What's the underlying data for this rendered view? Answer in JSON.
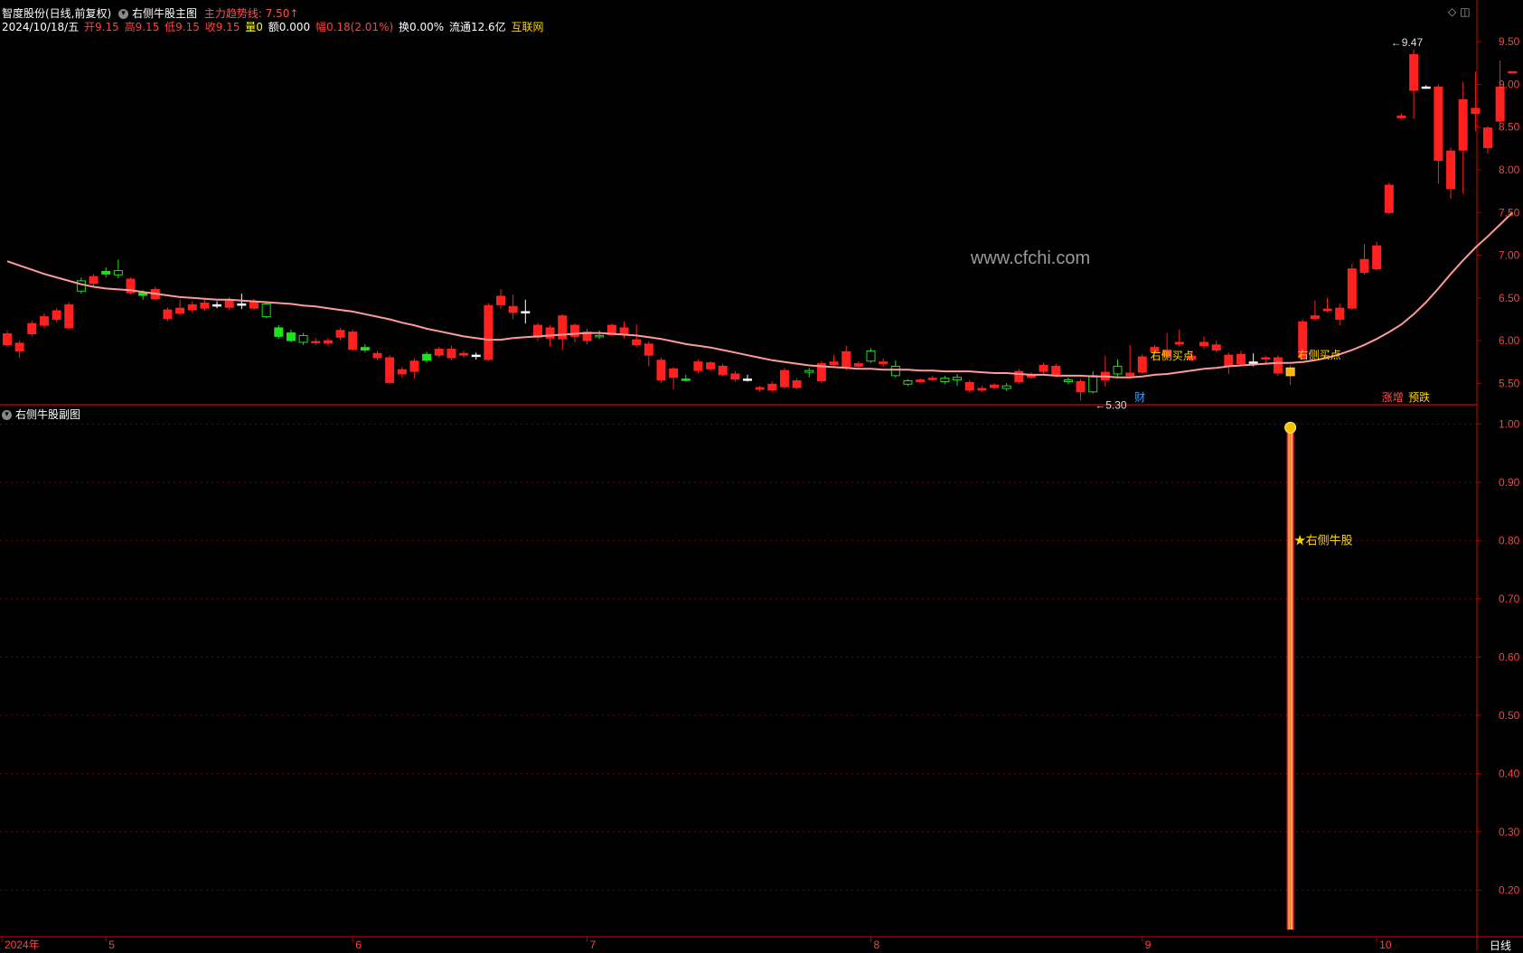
{
  "header": {
    "stock": "智度股份(日线,前复权)",
    "main_indicator": "右侧牛股主图",
    "trend_label": "主力趋势线: 7.50↑",
    "date": "2024/10/18/五",
    "open": "开9.15",
    "high": "高9.15",
    "low": "低9.15",
    "close": "收9.15",
    "volume": "量0",
    "amount": "额0.000",
    "change": "幅0.18(2.01%)",
    "turnover": "换0.00%",
    "float_cap": "流通12.6亿",
    "concept": "互联网"
  },
  "sub_header": {
    "title": "右侧牛股副图"
  },
  "watermark": "www.cfchi.com",
  "period_label": "日线",
  "colors": {
    "up": "#ff2020",
    "down": "#20e020",
    "flat": "#ffffff",
    "ma": "#ff9a9a",
    "axis": "#b00000",
    "grid": "#7a0000",
    "label_yellow": "#ffd700"
  },
  "chart_data": [
    {
      "type": "candlestick",
      "title": "右侧牛股主图",
      "ylim": [
        5.25,
        9.65
      ],
      "yticks": [
        "9.50",
        "9.00",
        "8.50",
        "8.00",
        "7.50",
        "7.00",
        "6.50",
        "6.00",
        "5.50"
      ],
      "xticks": [
        {
          "label": "2024年",
          "index": 0
        },
        {
          "label": "5",
          "index": 8
        },
        {
          "label": "6",
          "index": 28
        },
        {
          "label": "7",
          "index": 47
        },
        {
          "label": "8",
          "index": 70
        },
        {
          "label": "9",
          "index": 92
        },
        {
          "label": "10",
          "index": 111
        }
      ],
      "candles": [
        [
          5.95,
          6.08,
          6.12,
          5.92
        ],
        [
          5.88,
          5.97,
          6.0,
          5.8
        ],
        [
          6.08,
          6.2,
          6.23,
          6.05
        ],
        [
          6.18,
          6.28,
          6.32,
          6.15
        ],
        [
          6.25,
          6.35,
          6.38,
          6.22
        ],
        [
          6.15,
          6.42,
          6.45,
          6.13
        ],
        [
          6.7,
          6.58,
          6.74,
          6.55
        ],
        [
          6.67,
          6.75,
          6.78,
          6.62
        ],
        [
          6.81,
          6.78,
          6.86,
          6.74
        ],
        [
          6.82,
          6.77,
          6.95,
          6.73
        ],
        [
          6.56,
          6.72,
          6.74,
          6.54
        ],
        [
          6.56,
          6.53,
          6.59,
          6.48
        ],
        [
          6.49,
          6.6,
          6.63,
          6.47
        ],
        [
          6.26,
          6.36,
          6.39,
          6.23
        ],
        [
          6.32,
          6.38,
          6.48,
          6.3
        ],
        [
          6.36,
          6.42,
          6.46,
          6.33
        ],
        [
          6.38,
          6.44,
          6.48,
          6.35
        ],
        [
          6.42,
          6.42,
          6.46,
          6.38
        ],
        [
          6.39,
          6.47,
          6.51,
          6.36
        ],
        [
          6.43,
          6.43,
          6.55,
          6.37
        ],
        [
          6.38,
          6.45,
          6.49,
          6.36
        ],
        [
          6.43,
          6.28,
          6.46,
          6.26
        ],
        [
          6.15,
          6.05,
          6.18,
          6.02
        ],
        [
          6.09,
          6.0,
          6.13,
          5.98
        ],
        [
          6.06,
          5.98,
          6.09,
          5.95
        ],
        [
          5.99,
          5.99,
          6.03,
          5.95
        ],
        [
          5.97,
          6.0,
          6.03,
          5.94
        ],
        [
          6.04,
          6.12,
          6.15,
          6.01
        ],
        [
          5.9,
          6.1,
          6.13,
          5.88
        ],
        [
          5.92,
          5.89,
          5.96,
          5.86
        ],
        [
          5.8,
          5.85,
          5.88,
          5.77
        ],
        [
          5.51,
          5.8,
          5.83,
          5.49
        ],
        [
          5.61,
          5.66,
          5.69,
          5.57
        ],
        [
          5.64,
          5.76,
          5.79,
          5.56
        ],
        [
          5.84,
          5.77,
          5.87,
          5.74
        ],
        [
          5.83,
          5.9,
          5.93,
          5.8
        ],
        [
          5.8,
          5.9,
          5.94,
          5.77
        ],
        [
          5.83,
          5.85,
          5.88,
          5.8
        ],
        [
          5.83,
          5.83,
          5.86,
          5.78
        ],
        [
          5.78,
          6.41,
          6.44,
          5.76
        ],
        [
          6.42,
          6.52,
          6.6,
          6.37
        ],
        [
          6.33,
          6.4,
          6.54,
          6.25
        ],
        [
          6.34,
          6.34,
          6.48,
          6.2
        ],
        [
          6.04,
          6.18,
          6.21,
          6.0
        ],
        [
          6.03,
          6.15,
          6.18,
          5.93
        ],
        [
          6.02,
          6.29,
          6.31,
          5.89
        ],
        [
          6.05,
          6.18,
          6.2,
          5.98
        ],
        [
          6.0,
          6.1,
          6.14,
          5.96
        ],
        [
          6.06,
          6.05,
          6.12,
          6.02
        ],
        [
          6.07,
          6.18,
          6.2,
          6.05
        ],
        [
          6.07,
          6.15,
          6.22,
          6.03
        ],
        [
          5.95,
          6.01,
          6.19,
          5.92
        ],
        [
          5.83,
          5.96,
          5.99,
          5.7
        ],
        [
          5.54,
          5.77,
          5.8,
          5.5
        ],
        [
          5.57,
          5.67,
          5.69,
          5.43
        ],
        [
          5.55,
          5.54,
          5.6,
          5.52
        ],
        [
          5.65,
          5.75,
          5.78,
          5.62
        ],
        [
          5.67,
          5.74,
          5.76,
          5.64
        ],
        [
          5.6,
          5.7,
          5.73,
          5.58
        ],
        [
          5.55,
          5.61,
          5.64,
          5.52
        ],
        [
          5.55,
          5.55,
          5.6,
          5.52
        ],
        [
          5.43,
          5.45,
          5.47,
          5.4
        ],
        [
          5.42,
          5.49,
          5.52,
          5.4
        ],
        [
          5.46,
          5.65,
          5.68,
          5.44
        ],
        [
          5.45,
          5.53,
          5.56,
          5.43
        ],
        [
          5.65,
          5.63,
          5.68,
          5.57
        ],
        [
          5.53,
          5.73,
          5.76,
          5.5
        ],
        [
          5.72,
          5.75,
          5.83,
          5.7
        ],
        [
          5.68,
          5.87,
          5.94,
          5.65
        ],
        [
          5.7,
          5.73,
          5.76,
          5.68
        ],
        [
          5.88,
          5.76,
          5.91,
          5.74
        ],
        [
          5.73,
          5.75,
          5.79,
          5.69
        ],
        [
          5.7,
          5.59,
          5.77,
          5.57
        ],
        [
          5.53,
          5.49,
          5.55,
          5.47
        ],
        [
          5.52,
          5.54,
          5.56,
          5.5
        ],
        [
          5.56,
          5.56,
          5.59,
          5.53
        ],
        [
          5.56,
          5.52,
          5.59,
          5.49
        ],
        [
          5.57,
          5.54,
          5.61,
          5.47
        ],
        [
          5.42,
          5.51,
          5.54,
          5.39
        ],
        [
          5.42,
          5.44,
          5.47,
          5.4
        ],
        [
          5.45,
          5.48,
          5.5,
          5.43
        ],
        [
          5.47,
          5.44,
          5.5,
          5.41
        ],
        [
          5.52,
          5.64,
          5.67,
          5.49
        ],
        [
          5.57,
          5.6,
          5.63,
          5.55
        ],
        [
          5.64,
          5.71,
          5.74,
          5.61
        ],
        [
          5.6,
          5.7,
          5.73,
          5.57
        ],
        [
          5.54,
          5.52,
          5.57,
          5.49
        ],
        [
          5.4,
          5.52,
          5.55,
          5.3
        ],
        [
          5.59,
          5.4,
          5.64,
          5.38
        ],
        [
          5.54,
          5.63,
          5.82,
          5.46
        ],
        [
          5.7,
          5.61,
          5.78,
          5.58
        ],
        [
          5.59,
          5.62,
          5.95,
          5.55
        ],
        [
          5.63,
          5.81,
          5.84,
          5.61
        ],
        [
          5.87,
          5.92,
          5.95,
          5.84
        ],
        [
          5.82,
          5.89,
          6.09,
          5.79
        ],
        [
          5.96,
          5.98,
          6.13,
          5.93
        ],
        [
          5.78,
          5.82,
          5.88,
          5.76
        ],
        [
          5.94,
          5.98,
          6.05,
          5.9
        ],
        [
          5.89,
          5.95,
          6.0,
          5.86
        ],
        [
          5.7,
          5.83,
          5.86,
          5.61
        ],
        [
          5.73,
          5.84,
          5.88,
          5.71
        ],
        [
          5.75,
          5.75,
          5.85,
          5.7
        ],
        [
          5.79,
          5.8,
          5.82,
          5.72
        ],
        [
          5.62,
          5.8,
          5.83,
          5.59
        ],
        [
          5.59,
          5.68,
          5.71,
          5.48
        ],
        [
          5.8,
          6.22,
          6.25,
          5.78
        ],
        [
          6.26,
          6.29,
          6.47,
          6.23
        ],
        [
          6.35,
          6.37,
          6.5,
          6.33
        ],
        [
          6.25,
          6.38,
          6.43,
          6.18
        ],
        [
          6.38,
          6.84,
          6.9,
          6.36
        ],
        [
          6.8,
          6.95,
          7.13,
          6.77
        ],
        [
          6.84,
          7.11,
          7.16,
          6.82
        ],
        [
          7.5,
          7.82,
          7.85,
          7.48
        ],
        [
          8.61,
          8.63,
          8.66,
          8.59
        ],
        [
          8.93,
          9.35,
          9.41,
          8.6
        ],
        [
          8.97,
          8.97,
          8.99,
          8.95
        ],
        [
          8.11,
          8.97,
          9.0,
          7.84
        ],
        [
          7.78,
          8.22,
          8.26,
          7.66
        ],
        [
          8.23,
          8.82,
          9.03,
          7.72
        ],
        [
          8.66,
          8.72,
          9.15,
          8.45
        ],
        [
          8.26,
          8.49,
          8.51,
          8.19
        ],
        [
          8.57,
          8.97,
          9.28,
          8.54
        ],
        [
          9.15,
          9.15,
          9.15,
          9.15
        ]
      ],
      "ma": [
        6.93,
        6.88,
        6.83,
        6.78,
        6.74,
        6.7,
        6.66,
        6.63,
        6.61,
        6.6,
        6.59,
        6.57,
        6.55,
        6.53,
        6.51,
        6.5,
        6.49,
        6.48,
        6.48,
        6.47,
        6.46,
        6.45,
        6.44,
        6.43,
        6.41,
        6.4,
        6.38,
        6.36,
        6.34,
        6.31,
        6.28,
        6.25,
        6.21,
        6.18,
        6.14,
        6.11,
        6.08,
        6.05,
        6.03,
        6.01,
        6.01,
        6.03,
        6.04,
        6.05,
        6.06,
        6.07,
        6.08,
        6.09,
        6.09,
        6.08,
        6.07,
        6.06,
        6.04,
        6.02,
        5.99,
        5.96,
        5.94,
        5.92,
        5.89,
        5.86,
        5.83,
        5.8,
        5.77,
        5.75,
        5.73,
        5.71,
        5.7,
        5.69,
        5.68,
        5.67,
        5.67,
        5.66,
        5.66,
        5.66,
        5.65,
        5.65,
        5.64,
        5.64,
        5.64,
        5.63,
        5.62,
        5.62,
        5.61,
        5.6,
        5.6,
        5.59,
        5.59,
        5.59,
        5.58,
        5.58,
        5.57,
        5.57,
        5.58,
        5.6,
        5.61,
        5.63,
        5.65,
        5.67,
        5.68,
        5.7,
        5.71,
        5.72,
        5.73,
        5.74,
        5.74,
        5.75,
        5.77,
        5.8,
        5.84,
        5.89,
        5.95,
        6.02,
        6.1,
        6.19,
        6.31,
        6.45,
        6.61,
        6.78,
        6.94,
        7.09,
        7.22,
        7.36,
        7.5
      ],
      "annotations": [
        {
          "text": "5.30",
          "index": 88,
          "value": 5.3
        },
        {
          "text": "9.47",
          "index": 112,
          "value": 9.47
        },
        {
          "text": "右侧买点",
          "index": 92
        },
        {
          "text": "右侧买点",
          "index": 104
        },
        {
          "text": "财",
          "index": 91
        },
        {
          "text": "涨增",
          "index": 112
        },
        {
          "text": "预跌",
          "index": 114
        }
      ]
    },
    {
      "type": "bar",
      "title": "右侧牛股副图",
      "ylim": [
        0.12,
        1.03
      ],
      "yticks": [
        "1.00",
        "0.90",
        "0.80",
        "0.70",
        "0.60",
        "0.50",
        "0.40",
        "0.30",
        "0.20"
      ],
      "signal_index": 104,
      "signal_value": 1.0,
      "label": "★右侧牛股"
    }
  ]
}
